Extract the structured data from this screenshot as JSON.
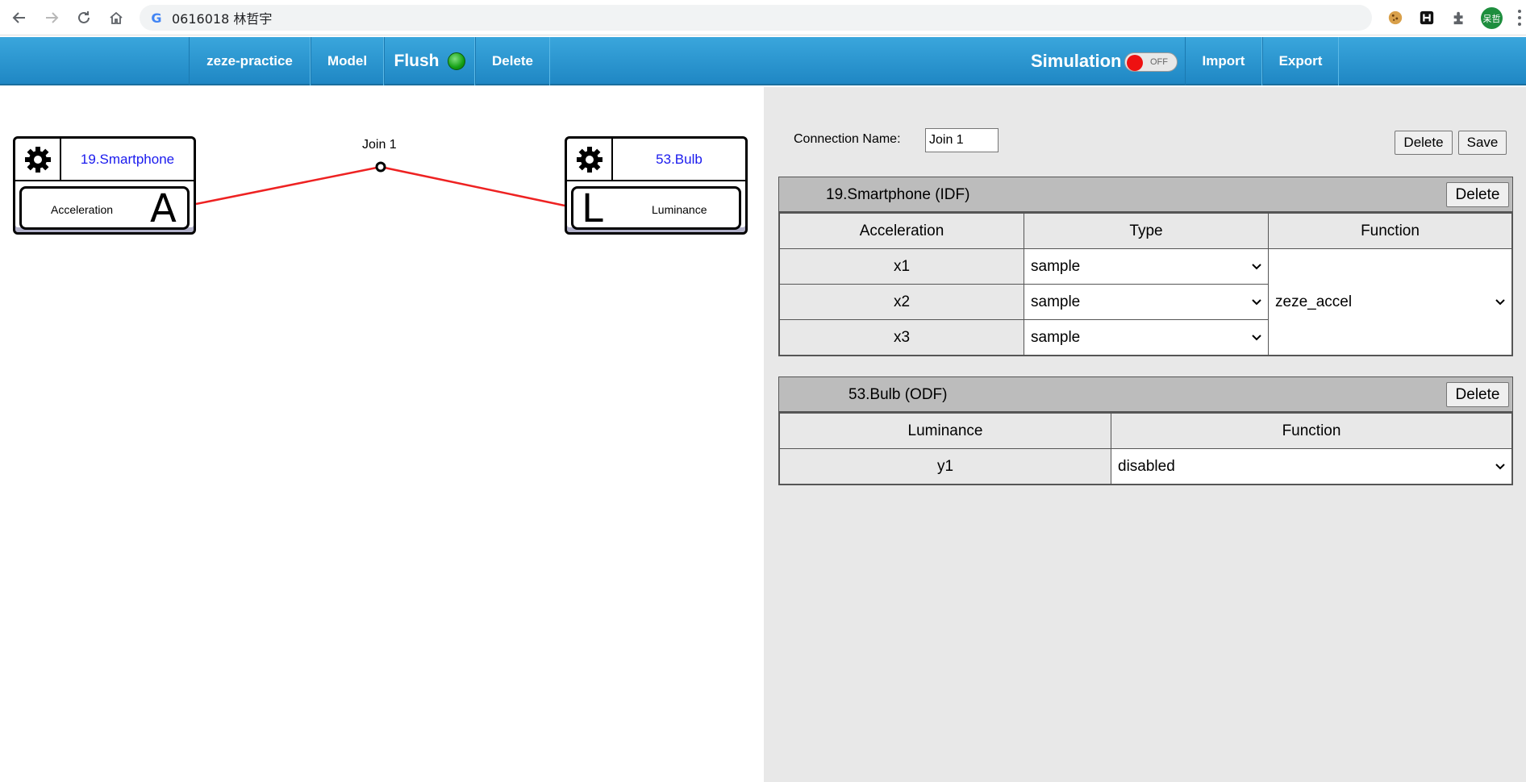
{
  "browser": {
    "url_text": "0616018 林哲宇",
    "avatar_text": "呆哲"
  },
  "nav": {
    "project": "zeze-practice",
    "model": "Model",
    "flush": "Flush",
    "delete": "Delete",
    "simulation": "Simulation",
    "simulation_toggle": "OFF",
    "import": "Import",
    "export": "Export"
  },
  "canvas": {
    "left_device": {
      "name": "19.Smartphone",
      "feature": "Acceleration",
      "letter": "A"
    },
    "right_device": {
      "name": "53.Bulb",
      "feature": "Luminance",
      "letter": "L"
    },
    "join_label": "Join 1",
    "line_color": "#ee2222"
  },
  "panel": {
    "connection_name_label": "Connection Name:",
    "connection_name_value": "Join 1",
    "delete_label": "Delete",
    "save_label": "Save",
    "idf": {
      "title": "19.Smartphone (IDF)",
      "delete_label": "Delete",
      "headers": [
        "Acceleration",
        "Type",
        "Function"
      ],
      "rows": [
        {
          "var": "x1",
          "type": "sample"
        },
        {
          "var": "x2",
          "type": "sample"
        },
        {
          "var": "x3",
          "type": "sample"
        }
      ],
      "function": "zeze_accel"
    },
    "odf": {
      "title": "53.Bulb (ODF)",
      "delete_label": "Delete",
      "headers": [
        "Luminance",
        "Function"
      ],
      "rows": [
        {
          "var": "y1",
          "function": "disabled"
        }
      ]
    }
  }
}
